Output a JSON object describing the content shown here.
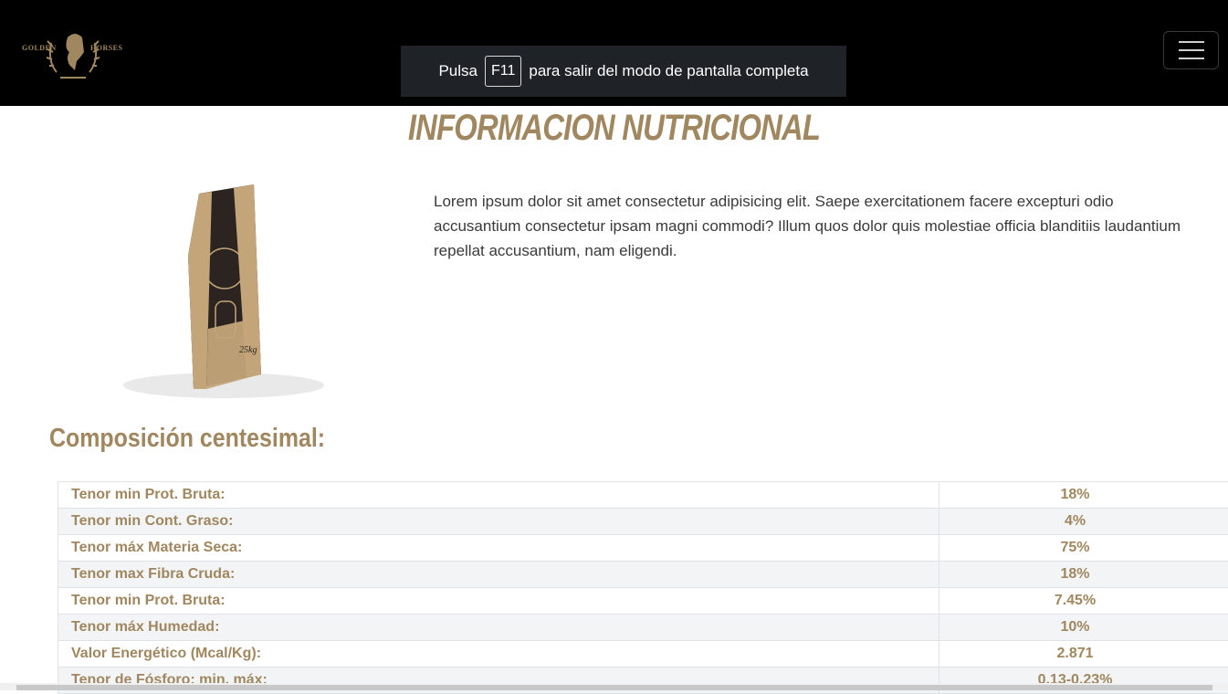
{
  "header": {
    "logo": {
      "left": "GOLDEN",
      "right": "HORSES"
    },
    "fullscreen_notice": {
      "before": "Pulsa",
      "key": "F11",
      "after": "para salir del modo de pantalla completa"
    },
    "menu_icon": "hamburger-icon"
  },
  "page": {
    "title": "INFORMACION NUTRICIONAL",
    "description": "Lorem ipsum dolor sit amet consectetur adipisicing elit. Saepe exercitationem facere excepturi odio accusantium consectetur ipsam magni commodi? Illum quos dolor quis molestiae officia blanditiis laudantium repellat accusantium, nam eligendi.",
    "section_title": "Composición centesimal:",
    "product_package_text": "25kg"
  },
  "table": {
    "rows": [
      {
        "label": "Tenor min Prot. Bruta:",
        "value": "18%"
      },
      {
        "label": "Tenor min Cont. Graso:",
        "value": "4%"
      },
      {
        "label": "Tenor máx Materia Seca:",
        "value": "75%"
      },
      {
        "label": "Tenor max Fibra Cruda:",
        "value": "18%"
      },
      {
        "label": "Tenor min Prot. Bruta:",
        "value": "7.45%"
      },
      {
        "label": "Tenor máx Humedad:",
        "value": "10%"
      },
      {
        "label": "Valor Energético (Mcal/Kg):",
        "value": "2.871"
      },
      {
        "label": "Tenor de Fósforo: min. máx:",
        "value": "0.13-0.23%"
      }
    ]
  },
  "colors": {
    "accent": "#a0875f",
    "header_bg": "#000000",
    "toast_bg": "#1f2226"
  }
}
